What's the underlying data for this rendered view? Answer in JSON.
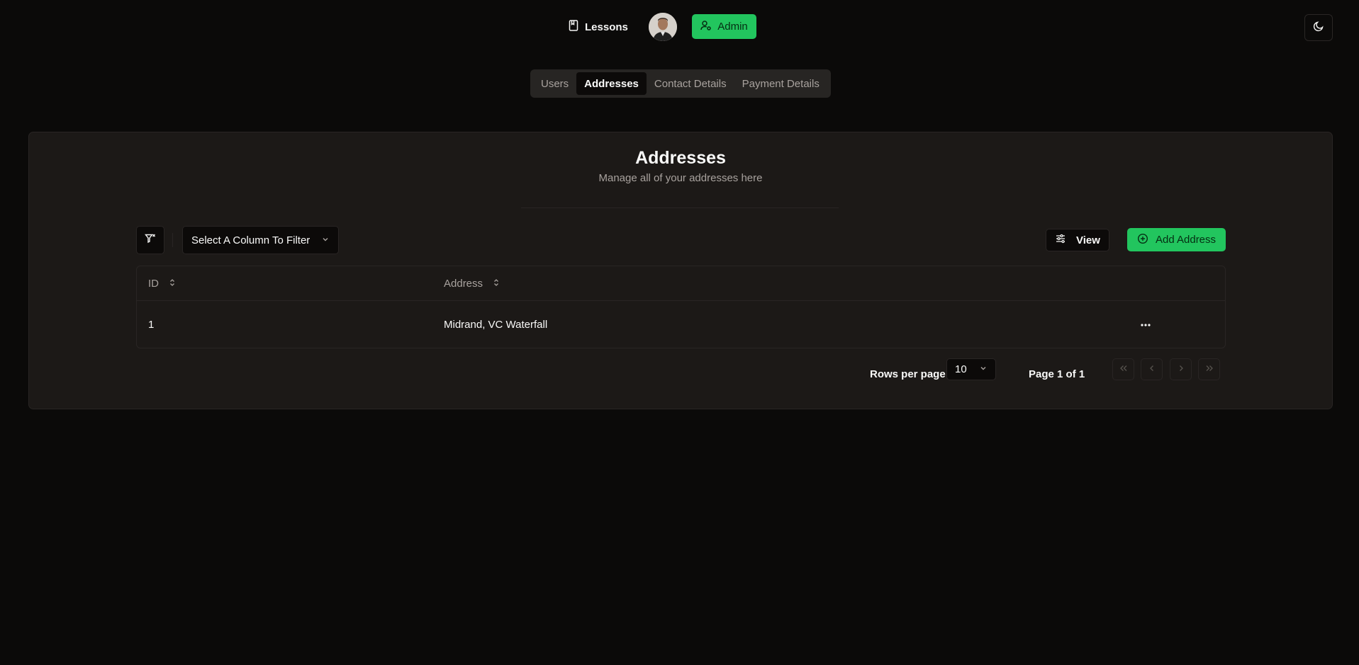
{
  "nav": {
    "lessons_label": "Lessons",
    "admin_label": "Admin",
    "icons": {
      "lessons": "book-icon",
      "admin": "user-cog-icon",
      "theme": "moon-icon"
    }
  },
  "tabs": [
    {
      "label": "Users",
      "active": false
    },
    {
      "label": "Addresses",
      "active": true
    },
    {
      "label": "Contact Details",
      "active": false
    },
    {
      "label": "Payment Details",
      "active": false
    }
  ],
  "card": {
    "title": "Addresses",
    "subtitle": "Manage all of your addresses here"
  },
  "toolbar": {
    "column_filter_label": "Select A Column To Filter",
    "view_label": "View",
    "add_label": "Add Address"
  },
  "table": {
    "columns": [
      "ID",
      "Address"
    ],
    "rows": [
      {
        "id": "1",
        "address": "Midrand, VC Waterfall"
      }
    ]
  },
  "pagination": {
    "rows_per_page_label": "Rows per page",
    "rows_per_page_value": "10",
    "page_label": "Page 1 of 1"
  },
  "colors": {
    "accent": "#22c55e",
    "background": "#0b0a09",
    "card": "#1c1917"
  }
}
